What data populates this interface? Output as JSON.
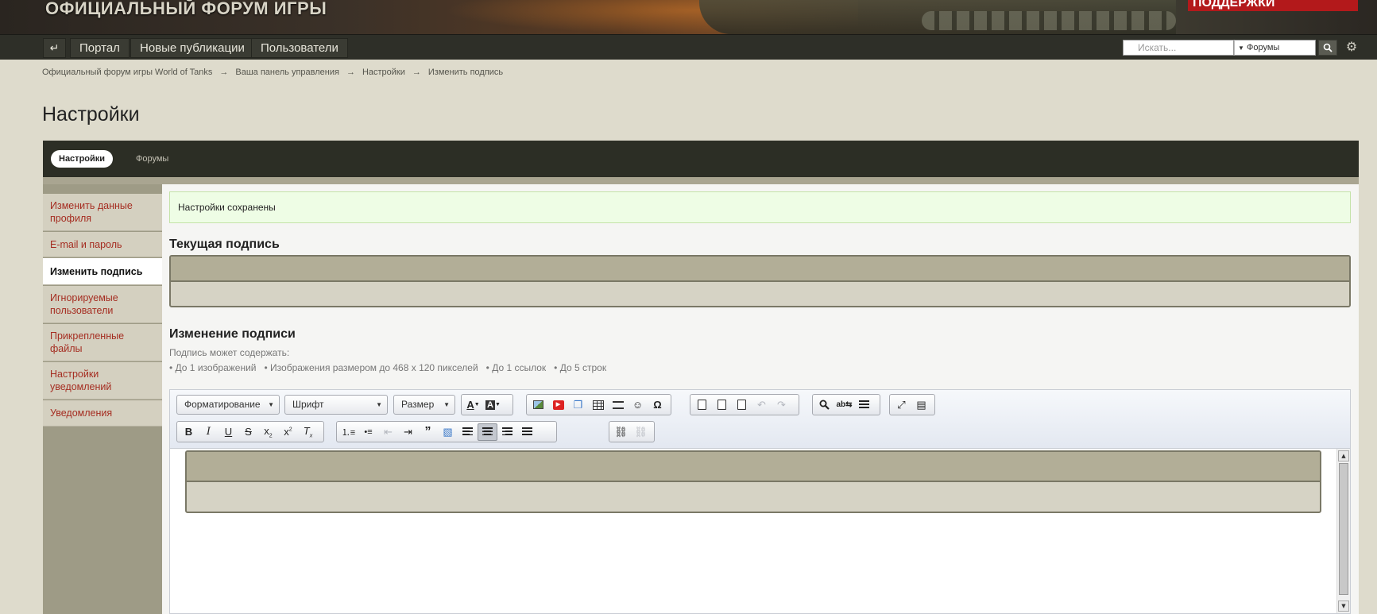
{
  "banner": {
    "title": "ОФИЦИАЛЬНЫЙ ФОРУМ ИГРЫ",
    "support_label": "ПОДДЕРЖКИ"
  },
  "topnav": {
    "home_icon": "↵",
    "items": [
      "Портал",
      "Новые публикации",
      "Пользователи"
    ],
    "search_placeholder": "Искать...",
    "search_scope": "Форумы",
    "search_button_icon": "search-icon",
    "settings_icon": "gear-icon"
  },
  "breadcrumb": [
    "Официальный форум игры World of Tanks",
    "Ваша панель управления",
    "Настройки",
    "Изменить подпись"
  ],
  "breadcrumb_sep": "→",
  "page_title": "Настройки",
  "tabs": {
    "active": "Настройки",
    "other": "Форумы"
  },
  "sidebar": {
    "items": [
      {
        "label": "Изменить данные профиля",
        "active": false
      },
      {
        "label": "E-mail и пароль",
        "active": false
      },
      {
        "label": "Изменить подпись",
        "active": true
      },
      {
        "label": "Игнорируемые пользователи",
        "active": false
      },
      {
        "label": "Прикрепленные файлы",
        "active": false
      },
      {
        "label": "Настройки уведомлений",
        "active": false
      },
      {
        "label": "Уведомления",
        "active": false
      }
    ]
  },
  "main": {
    "alert": "Настройки сохранены",
    "current_signature_heading": "Текущая подпись",
    "edit_signature_heading": "Изменение подписи",
    "signature_may_contain": "Подпись может содержать:",
    "limits": "• До 1 изображений   • Изображения размером до 468 x 120 пикселей   • До 1 ссылок   • До 5 строк"
  },
  "editor": {
    "format_label": "Форматирование",
    "font_label": "Шрифт",
    "size_label": "Размер",
    "alignment": "center"
  },
  "colors": {
    "accent_link": "#a52d21",
    "alert_bg": "#eefde5",
    "dark_bar": "#2c2e25"
  }
}
